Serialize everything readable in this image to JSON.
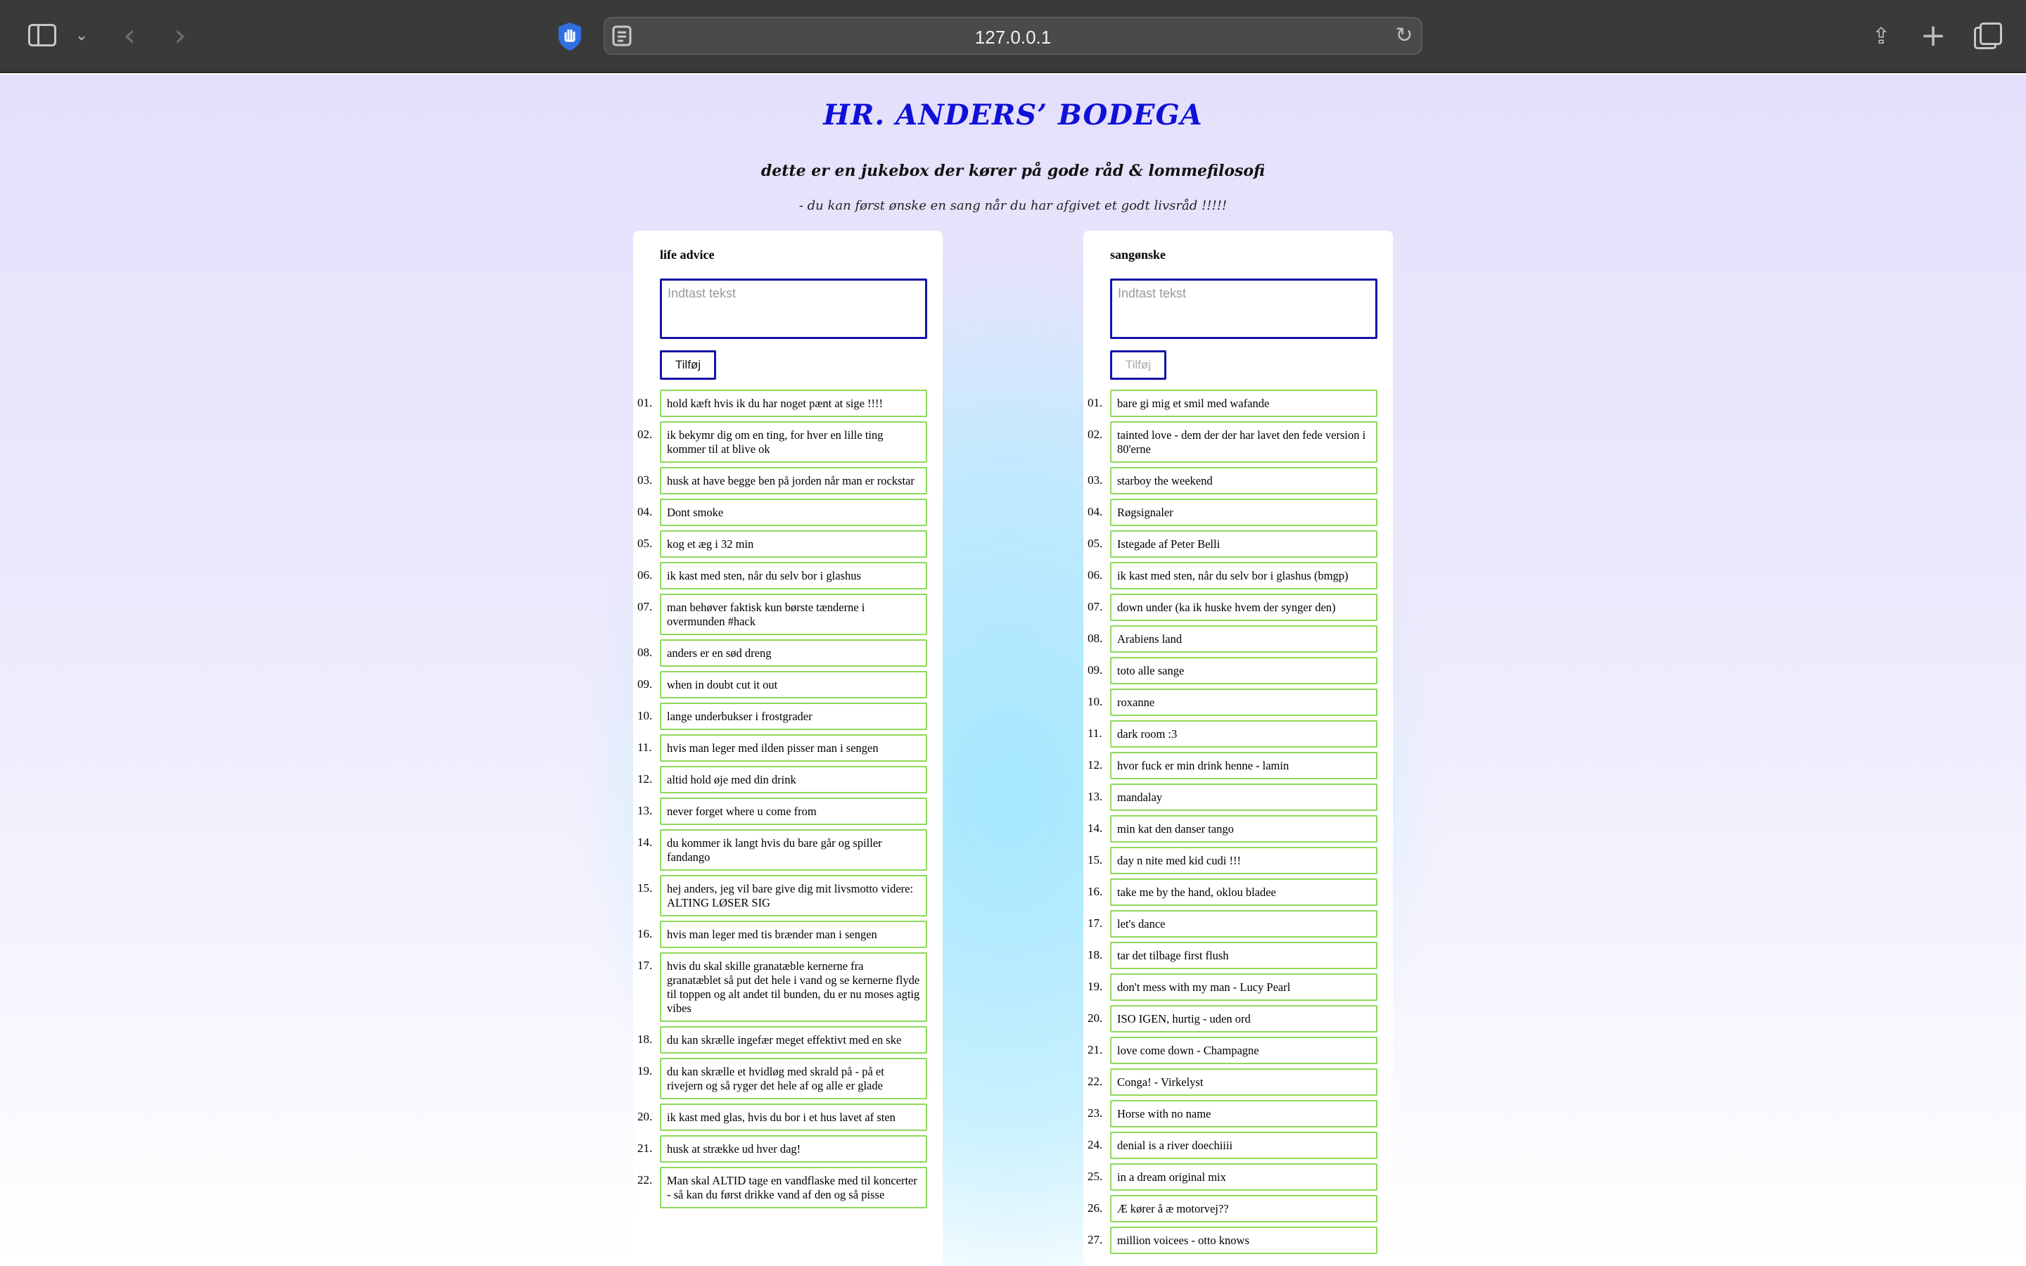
{
  "browser": {
    "url": "127.0.0.1"
  },
  "header": {
    "title": "HR. ANDERS’ BODEGA",
    "subtitle": "dette er en jukebox der kører på gode råd & lommefilosofi",
    "note": "- du kan først ønske en sang når du har afgivet et godt livsråd !!!!!"
  },
  "advice": {
    "title": "life advice",
    "placeholder": "Indtast tekst",
    "button": "Tilføj",
    "items": [
      {
        "num": "01.",
        "text": "hold kæft hvis ik du har noget pænt at sige !!!!"
      },
      {
        "num": "02.",
        "text": "ik bekymr dig om en ting, for hver en lille ting kommer til at blive ok"
      },
      {
        "num": "03.",
        "text": "husk at have begge ben på jorden når man er rockstar"
      },
      {
        "num": "04.",
        "text": "Dont smoke"
      },
      {
        "num": "05.",
        "text": "kog et æg i 32 min"
      },
      {
        "num": "06.",
        "text": "ik kast med sten, når du selv bor i glashus"
      },
      {
        "num": "07.",
        "text": "man behøver faktisk kun børste tænderne i overmunden #hack"
      },
      {
        "num": "08.",
        "text": "anders er en sød dreng"
      },
      {
        "num": "09.",
        "text": "when in doubt cut it out"
      },
      {
        "num": "10.",
        "text": "lange underbukser i frostgrader"
      },
      {
        "num": "11.",
        "text": "hvis man leger med ilden pisser man i sengen"
      },
      {
        "num": "12.",
        "text": "altid hold øje med din drink"
      },
      {
        "num": "13.",
        "text": "never forget where u come from"
      },
      {
        "num": "14.",
        "text": "du kommer ik langt hvis du bare går og spiller fandango"
      },
      {
        "num": "15.",
        "text": "hej anders, jeg vil bare give dig mit livsmotto videre: ALTING LØSER SIG"
      },
      {
        "num": "16.",
        "text": "hvis man leger med tis brænder man i sengen"
      },
      {
        "num": "17.",
        "text": "hvis du skal skille granatæble kernerne fra granatæblet så put det hele i vand og se kernerne flyde til toppen og alt andet til bunden, du er nu moses agtig vibes"
      },
      {
        "num": "18.",
        "text": "du kan skrælle ingefær meget effektivt med en ske"
      },
      {
        "num": "19.",
        "text": "du kan skrælle et hvidløg med skrald på - på et rivejern og så ryger det hele af og alle er glade"
      },
      {
        "num": "20.",
        "text": "ik kast med glas, hvis du bor i et hus lavet af sten"
      },
      {
        "num": "21.",
        "text": "husk at strække ud hver dag!"
      },
      {
        "num": "22.",
        "text": "Man skal ALTID tage en vandflaske med til koncerter - så kan du først drikke vand af den og så pisse"
      }
    ]
  },
  "songs": {
    "title": "sangønske",
    "placeholder": "Indtast tekst",
    "button": "Tilføj",
    "items": [
      {
        "num": "01.",
        "text": "bare gi mig et smil med wafande"
      },
      {
        "num": "02.",
        "text": "tainted love - dem der der har lavet den fede version i 80'erne"
      },
      {
        "num": "03.",
        "text": "starboy the weekend"
      },
      {
        "num": "04.",
        "text": "Røgsignaler"
      },
      {
        "num": "05.",
        "text": "Istegade af Peter Belli"
      },
      {
        "num": "06.",
        "text": "ik kast med sten, når du selv bor i glashus (bmgp)"
      },
      {
        "num": "07.",
        "text": "down under (ka ik huske hvem der synger den)"
      },
      {
        "num": "08.",
        "text": "Arabiens land"
      },
      {
        "num": "09.",
        "text": "toto alle sange"
      },
      {
        "num": "10.",
        "text": "roxanne"
      },
      {
        "num": "11.",
        "text": "dark room :3"
      },
      {
        "num": "12.",
        "text": "hvor fuck er min drink henne - lamin"
      },
      {
        "num": "13.",
        "text": "mandalay"
      },
      {
        "num": "14.",
        "text": "min kat den danser tango"
      },
      {
        "num": "15.",
        "text": "day n nite med kid cudi !!!"
      },
      {
        "num": "16.",
        "text": "take me by the hand, oklou bladee"
      },
      {
        "num": "17.",
        "text": "let's dance"
      },
      {
        "num": "18.",
        "text": "tar det tilbage first flush"
      },
      {
        "num": "19.",
        "text": "don't mess with my man - Lucy Pearl"
      },
      {
        "num": "20.",
        "text": "ISO IGEN, hurtig - uden ord"
      },
      {
        "num": "21.",
        "text": "love come down - Champagne"
      },
      {
        "num": "22.",
        "text": "Conga! - Virkelyst"
      },
      {
        "num": "23.",
        "text": "Horse with no name"
      },
      {
        "num": "24.",
        "text": "denial is a river doechiiii"
      },
      {
        "num": "25.",
        "text": "in a dream original mix"
      },
      {
        "num": "26.",
        "text": "Æ kører å æ motorvej??"
      },
      {
        "num": "27.",
        "text": "million voicees - otto knows"
      }
    ]
  }
}
